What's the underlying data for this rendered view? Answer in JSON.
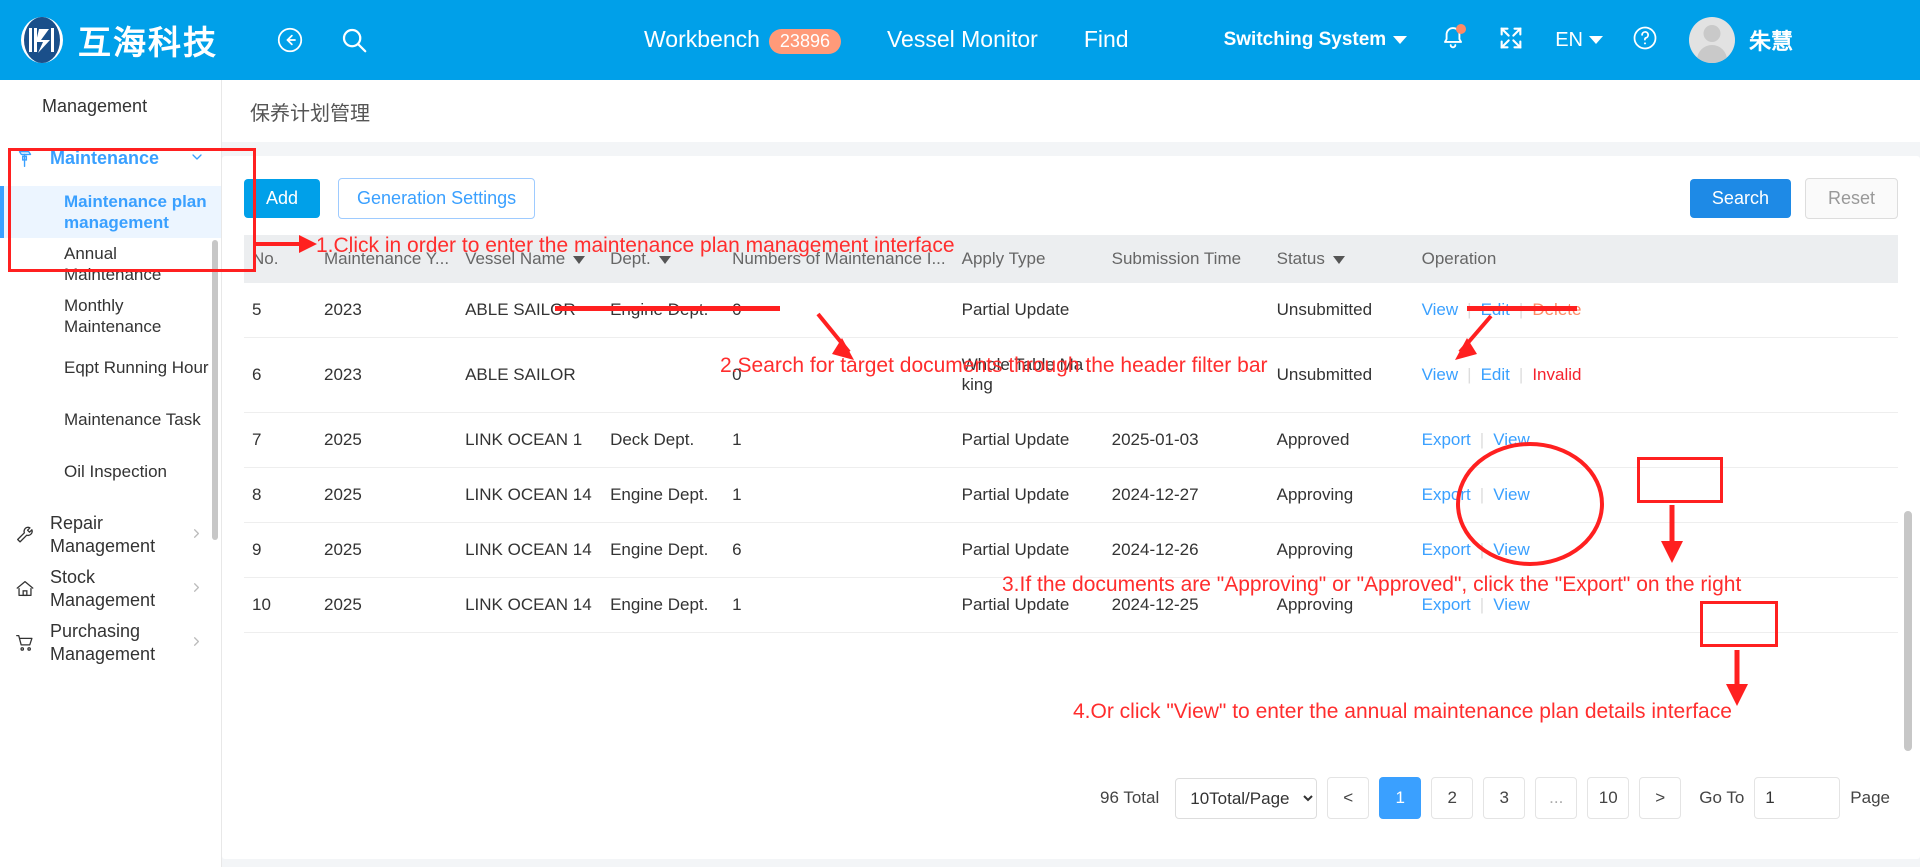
{
  "header": {
    "brand_name": "互海科技",
    "back_icon": "back-arrow-icon",
    "search_icon": "search-icon",
    "workbench_label": "Workbench",
    "workbench_count": "23896",
    "vessel_monitor_label": "Vessel Monitor",
    "find_label": "Find",
    "switching_system_label": "Switching System",
    "bell_icon": "notification-bell-icon",
    "fullscreen_icon": "fullscreen-expand-icon",
    "language_label": "EN",
    "help_icon": "help-circle-icon",
    "avatar_icon": "user-avatar",
    "username": "朱慧"
  },
  "sidebar": {
    "top_text": "Management",
    "group": {
      "label": "Maintenance",
      "icon": "hammer-icon",
      "chevron": "chevron-down-icon"
    },
    "sub_items": [
      "Maintenance plan management",
      "Annual Maintenance",
      "Monthly Maintenance",
      "Eqpt Running Hour",
      "Maintenance Task",
      "Oil Inspection"
    ],
    "items": [
      {
        "label": "Repair Management",
        "icon": "wrench-icon",
        "chevron": "chevron-right-icon"
      },
      {
        "label": "Stock Management",
        "icon": "home-icon",
        "chevron": "chevron-right-icon"
      },
      {
        "label": "Purchasing Management",
        "icon": "cart-icon",
        "chevron": "chevron-right-icon"
      }
    ]
  },
  "page": {
    "title": "保养计划管理"
  },
  "toolbar": {
    "add_label": "Add",
    "generation_settings_label": "Generation Settings",
    "search_label": "Search",
    "reset_label": "Reset"
  },
  "table": {
    "columns": [
      {
        "label": "No.",
        "filter": false
      },
      {
        "label": "Maintenance Y...",
        "filter": false
      },
      {
        "label": "Vessel Name",
        "filter": true
      },
      {
        "label": "Dept.",
        "filter": true
      },
      {
        "label": "Numbers of Maintenance I...",
        "filter": false
      },
      {
        "label": "Apply Type",
        "filter": false
      },
      {
        "label": "Submission Time",
        "filter": false
      },
      {
        "label": "Status",
        "filter": true
      },
      {
        "label": "Operation",
        "filter": false
      }
    ],
    "rows": [
      {
        "no": "5",
        "year": "2023",
        "vessel": "ABLE SAILOR",
        "dept": "Engine Dept.",
        "numbers": "0",
        "apply_type": "Partial Update",
        "submission_time": "",
        "status": "Unsubmitted",
        "ops": [
          {
            "label": "View",
            "kind": "link"
          },
          {
            "label": "Edit",
            "kind": "link"
          },
          {
            "label": "Delete",
            "kind": "delete"
          }
        ]
      },
      {
        "no": "6",
        "year": "2023",
        "vessel": "ABLE SAILOR",
        "dept": "",
        "numbers": "0",
        "apply_type": "Whole Table Ma king",
        "submission_time": "",
        "status": "Unsubmitted",
        "ops": [
          {
            "label": "View",
            "kind": "link"
          },
          {
            "label": "Edit",
            "kind": "link"
          },
          {
            "label": "Invalid",
            "kind": "invalid"
          }
        ]
      },
      {
        "no": "7",
        "year": "2025",
        "vessel": "LINK OCEAN 1",
        "dept": "Deck Dept.",
        "numbers": "1",
        "apply_type": "Partial Update",
        "submission_time": "2025-01-03",
        "status": "Approved",
        "ops": [
          {
            "label": "Export",
            "kind": "link"
          },
          {
            "label": "View",
            "kind": "link"
          }
        ]
      },
      {
        "no": "8",
        "year": "2025",
        "vessel": "LINK OCEAN 14",
        "dept": "Engine Dept.",
        "numbers": "1",
        "apply_type": "Partial Update",
        "submission_time": "2024-12-27",
        "status": "Approving",
        "ops": [
          {
            "label": "Export",
            "kind": "link"
          },
          {
            "label": "View",
            "kind": "link"
          }
        ]
      },
      {
        "no": "9",
        "year": "2025",
        "vessel": "LINK OCEAN 14",
        "dept": "Engine Dept.",
        "numbers": "6",
        "apply_type": "Partial Update",
        "submission_time": "2024-12-26",
        "status": "Approving",
        "ops": [
          {
            "label": "Export",
            "kind": "link"
          },
          {
            "label": "View",
            "kind": "link"
          }
        ]
      },
      {
        "no": "10",
        "year": "2025",
        "vessel": "LINK OCEAN 14",
        "dept": "Engine Dept.",
        "numbers": "1",
        "apply_type": "Partial Update",
        "submission_time": "2024-12-25",
        "status": "Approving",
        "ops": [
          {
            "label": "Export",
            "kind": "link"
          },
          {
            "label": "View",
            "kind": "link"
          }
        ]
      }
    ]
  },
  "pagination": {
    "total_label": "96 Total",
    "page_size_label": "10Total/Page",
    "prev_label": "<",
    "pages": [
      "1",
      "2",
      "3",
      "...",
      "10"
    ],
    "current_page": "1",
    "next_label": ">",
    "goto_label": "Go To",
    "goto_value": "1",
    "page_word": "Page"
  },
  "annotations": [
    {
      "id": "a1",
      "text": "1.Click  in order to enter the maintenance plan management interface"
    },
    {
      "id": "a2",
      "text": "2.Search for target documents through the header filter bar"
    },
    {
      "id": "a3",
      "text": "3.If the documents are \"Approving\" or \"Approved\", click the \"Export\" on the right"
    },
    {
      "id": "a4",
      "text": "4.Or click \"View\" to enter the annual maintenance plan details interface"
    }
  ],
  "colors": {
    "brand_blue": "#00a0e9",
    "link_blue": "#3aa0ff",
    "annotation_red": "#ff2d2d",
    "badge_orange": "#ff9a79"
  }
}
